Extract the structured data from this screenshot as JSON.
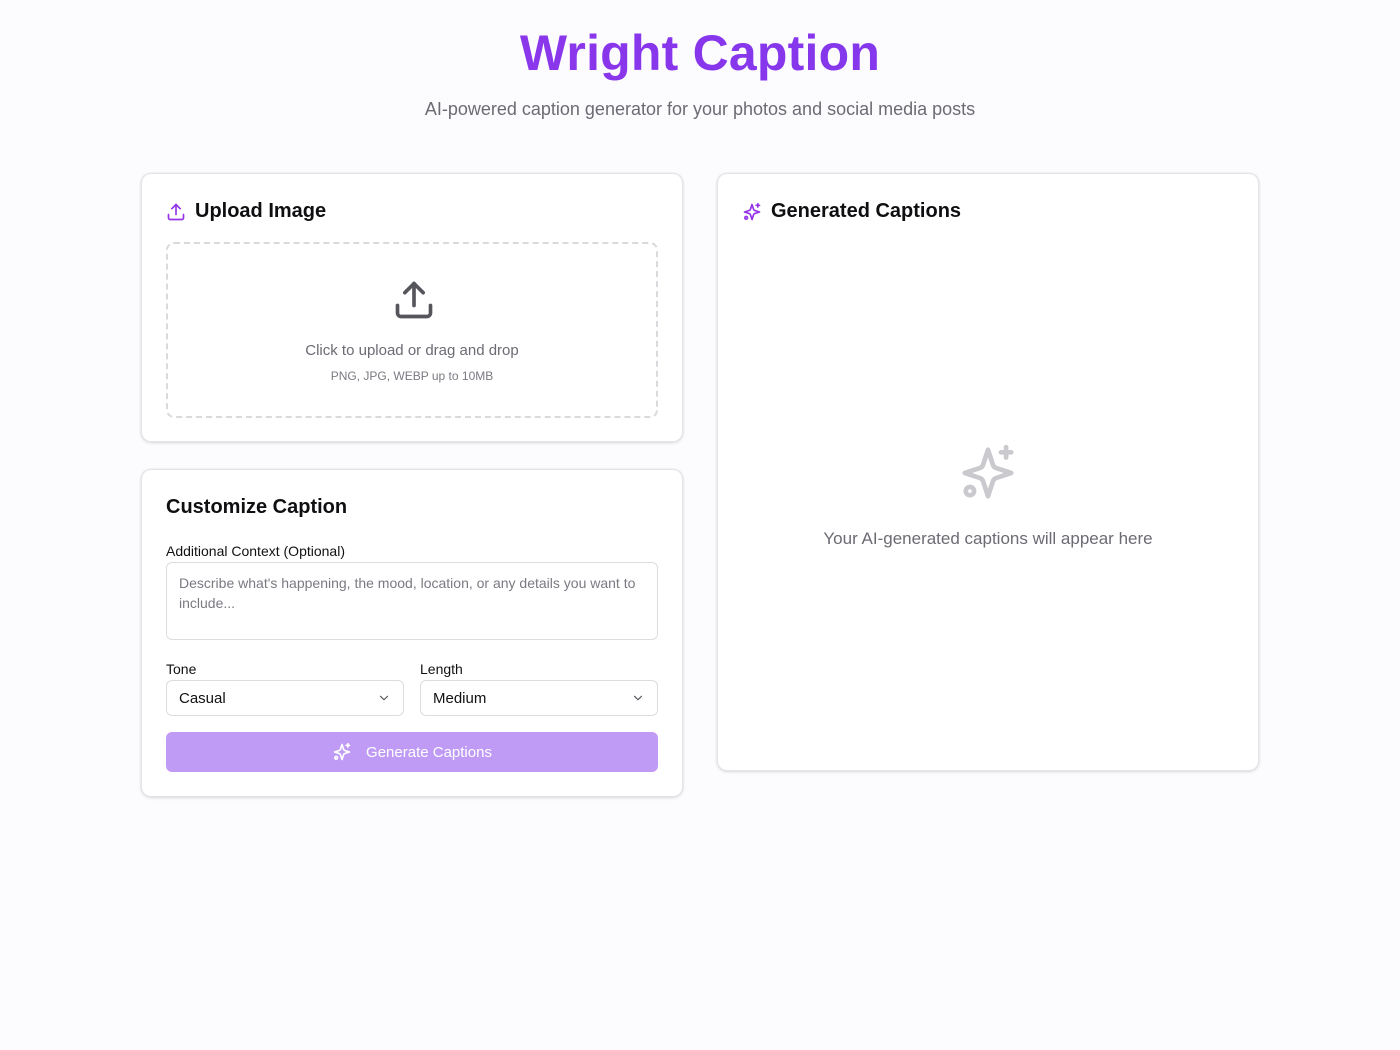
{
  "header": {
    "title": "Wright Caption",
    "subtitle": "AI-powered caption generator for your photos and social media posts"
  },
  "upload": {
    "title": "Upload Image",
    "icon": "upload-icon",
    "dropzone_text": "Click to upload or drag and drop",
    "dropzone_hint": "PNG, JPG, WEBP up to 10MB"
  },
  "customize": {
    "title": "Customize Caption",
    "context_label": "Additional Context (Optional)",
    "context_value": "",
    "context_placeholder": "Describe what's happening, the mood, location, or any details you want to include...",
    "tone_label": "Tone",
    "tone_value": "Casual",
    "length_label": "Length",
    "length_value": "Medium",
    "generate_label": "Generate Captions"
  },
  "results": {
    "title": "Generated Captions",
    "icon": "sparkles-icon",
    "empty_text": "Your AI-generated captions will appear here"
  },
  "colors": {
    "accent": "#9333ea",
    "button_disabled": "#c09bf5",
    "muted_text": "#6b6b73",
    "empty_icon": "#c9c9ce"
  }
}
